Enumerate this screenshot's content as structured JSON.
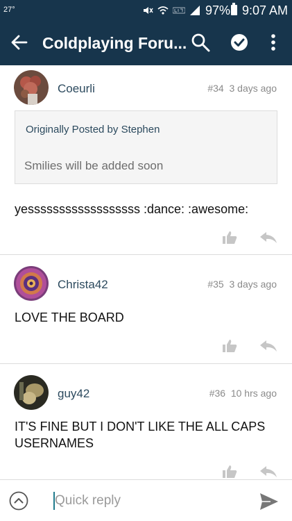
{
  "status_bar": {
    "temperature": "27°",
    "battery": "97%",
    "time": "9:07 AM"
  },
  "app_bar": {
    "title": "Coldplaying Foru...",
    "icons": [
      "back-arrow-icon",
      "search-icon",
      "check-circle-icon",
      "more-vert-icon"
    ]
  },
  "posts": [
    {
      "username": "Coeurli",
      "number": "#34",
      "time": "3 days ago",
      "quote": {
        "by": "Originally Posted by Stephen",
        "text": "Smilies will be added soon"
      },
      "body": "yessssssssssssssssss :dance: :awesome:"
    },
    {
      "username": "Christa42",
      "number": "#35",
      "time": "3 days ago",
      "body": "LOVE THE BOARD"
    },
    {
      "username": "guy42",
      "number": "#36",
      "time": "10 hrs ago",
      "body_lines": [
        "IT'S FINE BUT I DON'T LIKE THE ALL CAPS",
        "USERNAMES"
      ]
    }
  ],
  "bottom_bar": {
    "placeholder": "Quick reply",
    "icons": [
      "collapse-up-icon",
      "send-icon"
    ]
  },
  "colors": {
    "header_bg": "#17354c",
    "username": "#2c4a5e",
    "icon_gray": "#c6c6c6"
  }
}
